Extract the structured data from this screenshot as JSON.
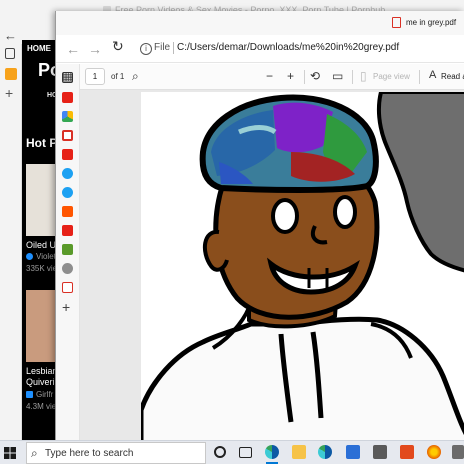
{
  "background_window": {
    "title": "Free Porn Videos & Sex Movies - Porno, XXX, Porn Tube | Pornhub",
    "nav_home": "HOME",
    "logo_fragment": "Po",
    "ho_fragment": "HO",
    "hot_fragment": "Hot P",
    "items": [
      {
        "title": "Oiled Up",
        "channel": "Violet",
        "views": "335K vie"
      },
      {
        "title": "Lesbian",
        "title2": "Quivering",
        "channel": "Girlfr",
        "views": "4.3M vie"
      }
    ]
  },
  "window": {
    "tab_title": "me in grey.pdf",
    "file_label": "File",
    "url": "C:/Users/demar/Downloads/me%20in%20grey.pdf"
  },
  "pdf_toolbar": {
    "page_number": "1",
    "page_count": "of 1",
    "page_view_label": "Page view",
    "read_aloud_label": "Read a"
  },
  "taskbar": {
    "search_placeholder": "Type here to search"
  },
  "colors": {
    "accent": "#0078d4",
    "skin": "#8a4e1c",
    "canvas_bg": "#e8e8e8"
  }
}
